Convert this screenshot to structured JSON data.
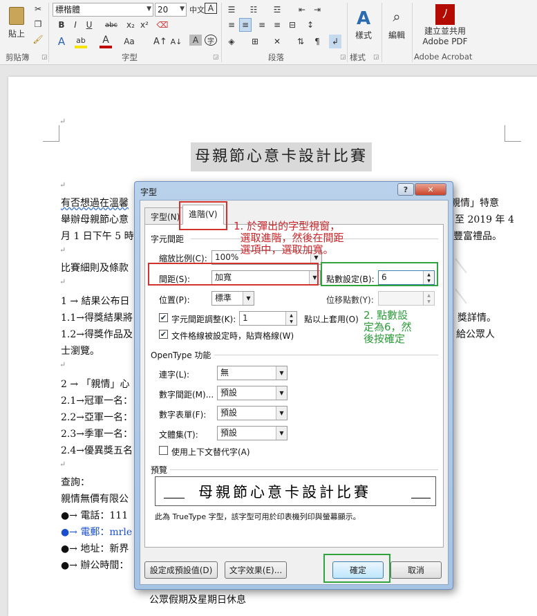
{
  "ribbon": {
    "font_name": "標楷體",
    "font_size": "20",
    "clipboard": {
      "paste": "貼上",
      "label": "剪貼簿"
    },
    "font_group_label": "字型",
    "paragraph_group_label": "段落",
    "styles": {
      "label": "樣式",
      "group_label": "樣式"
    },
    "editing": {
      "label": "編輯"
    },
    "acrobat": {
      "line1": "建立並共用",
      "line2": "Adobe PDF",
      "group_label": "Adobe Acrobat"
    },
    "format_buttons": [
      "B",
      "I",
      "U",
      "abc",
      "x₂",
      "x²"
    ],
    "font_row2": [
      "A",
      "ab",
      "A",
      "Aa"
    ],
    "colors": {
      "highlight": "#f5e300",
      "font_color": "#c00000",
      "acrobat_red": "#b30b00",
      "styles_blue": "#2b6cb0"
    }
  },
  "document": {
    "title": "母親節心意卡設計比賽",
    "lines": [
      {
        "left": "有否想過在溫馨",
        "right": "親情」特意"
      },
      {
        "left": "舉辦母親節心意",
        "right": "至 2019 年 4"
      },
      {
        "left": "月 1 日下午 5 時",
        "right": "豐富禮品。"
      },
      {
        "left": "比賽細則及條款",
        "right": ""
      },
      {
        "left": "1 →  結果公布日",
        "right": ""
      },
      {
        "left": "1.1→得獎結果將",
        "right": "獎詳情。"
      },
      {
        "left": "1.2→得獎作品及",
        "right": "給公眾人"
      },
      {
        "left": "士瀏覽。",
        "right": ""
      },
      {
        "left": "2 → 「親情」心",
        "right": ""
      },
      {
        "left": "2.1→冠軍一名：",
        "right": ""
      },
      {
        "left": "2.2→亞軍一名：",
        "right": ""
      },
      {
        "left": "2.3→季軍一名：",
        "right": ""
      },
      {
        "left": "2.4→優異獎五名",
        "right": ""
      },
      {
        "left": "查詢：",
        "right": ""
      },
      {
        "left": "親情無價有限公",
        "right": ""
      },
      {
        "left": "●→ 電話：111",
        "right": ""
      },
      {
        "left": "●→ 電郵：mrle",
        "right": ""
      },
      {
        "left": "●→ 地址：新界",
        "right": ""
      },
      {
        "left": "●→ 辦公時間：",
        "right": ""
      }
    ],
    "bottom_line": "公眾假期及星期日休息"
  },
  "dialog": {
    "title": "字型",
    "tabs": [
      {
        "label": "字型(N)",
        "active": false
      },
      {
        "label": "進階(V)",
        "active": true
      }
    ],
    "spacing_section": "字元間距",
    "scale": {
      "label": "縮放比例(C):",
      "value": "100%"
    },
    "spacing": {
      "label": "間距(S):",
      "value": "加寬"
    },
    "points1": {
      "label": "點數設定(B):",
      "value": "6"
    },
    "position": {
      "label": "位置(P):",
      "value": "標準"
    },
    "points2": {
      "label": "位移點數(Y):",
      "value": ""
    },
    "kerning": {
      "label": "字元間距調整(K):",
      "value": "1",
      "suffix": "點以上套用(O)",
      "checked": true
    },
    "grid": {
      "label": "文件格線被設定時，貼齊格線(W)",
      "checked": true
    },
    "opentype_section": "OpenType 功能",
    "ligatures": {
      "label": "連字(L):",
      "value": "無"
    },
    "number_spacing": {
      "label": "數字間距(M)...",
      "value": "預設"
    },
    "number_forms": {
      "label": "數字表單(F):",
      "value": "預設"
    },
    "stylistic_sets": {
      "label": "文體集(T):",
      "value": "預設"
    },
    "contextual": {
      "label": "使用上下文替代字(A)",
      "checked": false
    },
    "preview_section": "預覽",
    "preview_text": "母親節心意卡設計比賽",
    "preview_note": "此為 TrueType 字型，該字型可用於印表機列印與螢幕顯示。",
    "buttons": {
      "default": "設定成預設值(D)",
      "effects": "文字效果(E)...",
      "ok": "確定",
      "cancel": "取消"
    },
    "help": "?",
    "close": "✕"
  },
  "annotations": {
    "note1": "1. 於彈出的字型視窗，\n  選取進階，然後在間距\n  選項中，選取加寬。",
    "note2": "2. 點數設\n定為6，然\n後按確定",
    "colors": {
      "red": "#d2312c",
      "green": "#2fa33d"
    }
  }
}
